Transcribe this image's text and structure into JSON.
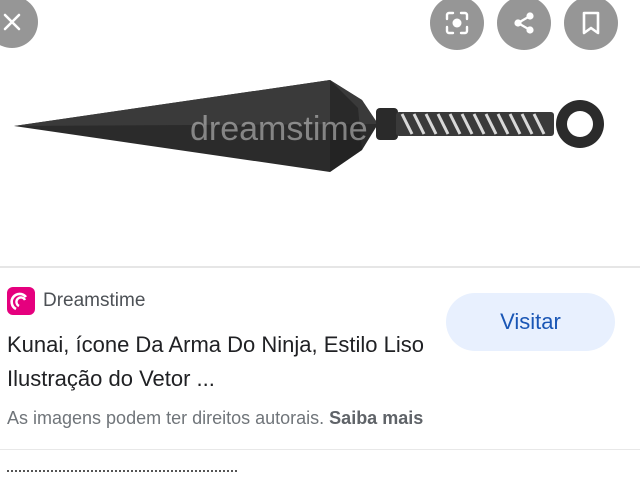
{
  "source": {
    "name": "Dreamstime",
    "logo_color": "#e5007e"
  },
  "result": {
    "title": "Kunai, ícone Da Arma Do Ninja, Estilo Liso Ilustração do Vetor ..."
  },
  "actions": {
    "visit_label": "Visitar"
  },
  "rights": {
    "text": "As imagens podem ter direitos autorais.",
    "link": "Saiba mais"
  },
  "image": {
    "watermark": "dreamstime"
  },
  "icons": {
    "close": "close-icon",
    "lens": "lens-icon",
    "share": "share-icon",
    "save": "bookmark-icon"
  },
  "colors": {
    "accent_button_bg": "#e8f0fe",
    "accent_button_text": "#1a56b5",
    "overlay_btn": "#6e6e6e"
  }
}
